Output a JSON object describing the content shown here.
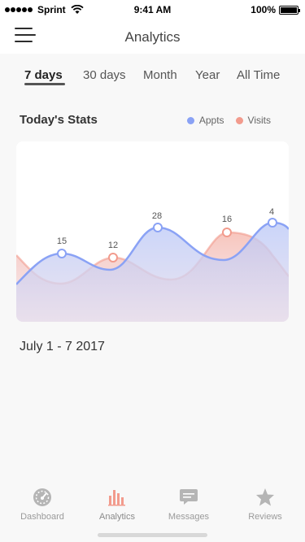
{
  "status_bar": {
    "carrier": "Sprint",
    "time": "9:41 AM",
    "battery": "100%"
  },
  "nav": {
    "title": "Analytics"
  },
  "tabs": [
    {
      "label": "7 days",
      "active": true
    },
    {
      "label": "30 days",
      "active": false
    },
    {
      "label": "Month",
      "active": false
    },
    {
      "label": "Year",
      "active": false
    },
    {
      "label": "All Time",
      "active": false
    }
  ],
  "stats": {
    "title": "Today's Stats",
    "legend": [
      {
        "label": "Appts",
        "color": "#8aa2f5"
      },
      {
        "label": "Visits",
        "color": "#f29b8d"
      }
    ]
  },
  "chart_data": {
    "type": "area",
    "series": [
      {
        "name": "Appts",
        "color": "#8aa2f5",
        "points": [
          {
            "label": "15"
          },
          {
            "label": "28"
          },
          {
            "label": "4"
          }
        ]
      },
      {
        "name": "Visits",
        "color": "#f29b8d",
        "points": [
          {
            "label": "12"
          },
          {
            "label": "16"
          }
        ]
      }
    ]
  },
  "date_range": "July 1 - 7 2017",
  "tabbar": [
    {
      "label": "Dashboard",
      "icon": "gauge-icon",
      "active": false
    },
    {
      "label": "Analytics",
      "icon": "bar-chart-icon",
      "active": true
    },
    {
      "label": "Messages",
      "icon": "chat-icon",
      "active": false
    },
    {
      "label": "Reviews",
      "icon": "star-icon",
      "active": false
    }
  ]
}
